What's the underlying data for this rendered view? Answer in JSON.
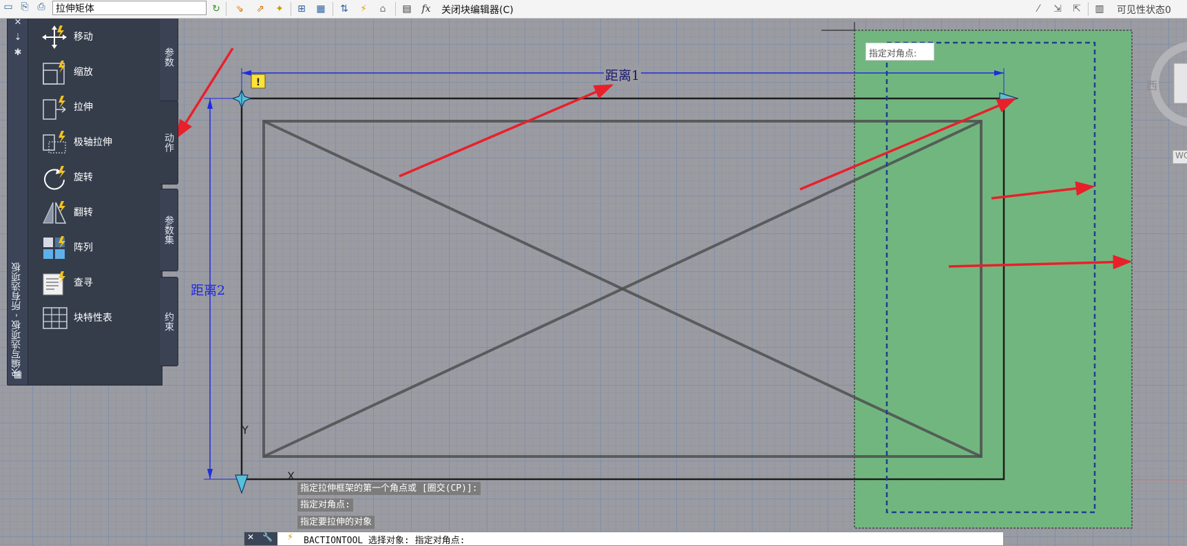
{
  "toolbar": {
    "block_name_value": "拉伸矩体",
    "close_block_editor_label": "关闭块编辑器(C)",
    "visibility_state_label": "可见性状态0",
    "icons": [
      "save-block-icon",
      "test-block-icon",
      "authoring-palettes-icon",
      "parameter-manager-icon",
      "attribute-definition-icon",
      "block-table-icon",
      "fx-icon"
    ]
  },
  "palette": {
    "title": "块编写选项板 - 所有选项板",
    "tabs": [
      {
        "label": "参数",
        "active": false
      },
      {
        "label": "动作",
        "active": true
      },
      {
        "label": "参数集",
        "active": false
      },
      {
        "label": "约束",
        "active": false
      }
    ],
    "tools": [
      {
        "label": "移动",
        "icon": "move-action-icon"
      },
      {
        "label": "缩放",
        "icon": "scale-action-icon"
      },
      {
        "label": "拉伸",
        "icon": "stretch-action-icon"
      },
      {
        "label": "极轴拉伸",
        "icon": "polar-stretch-action-icon"
      },
      {
        "label": "旋转",
        "icon": "rotate-action-icon"
      },
      {
        "label": "翻转",
        "icon": "flip-action-icon"
      },
      {
        "label": "阵列",
        "icon": "array-action-icon"
      },
      {
        "label": "查寻",
        "icon": "lookup-action-icon"
      },
      {
        "label": "块特性表",
        "icon": "block-properties-table-icon"
      }
    ]
  },
  "drawing": {
    "distance1_label": "距离1",
    "distance2_label": "距离2",
    "corner_prompt": "指定对角点:",
    "axis_y": "Y",
    "axis_x": "X",
    "alert_symbol": "!"
  },
  "command_history": [
    "指定拉伸框架的第一个角点或 [圈交(CP)]:",
    "指定对角点:",
    "指定要拉伸的对象"
  ],
  "command_line": "BACTIONTOOL 选择对象: 指定对角点:",
  "viewcube": {
    "direction": "西",
    "wcs": "WC"
  },
  "colors": {
    "canvas": "#9b9ba2",
    "palette_bg": "#353d4b",
    "selection_fill": "#6fb87c",
    "dimension_blue": "#1f2be0",
    "annotation_arrow": "#e8202a"
  }
}
